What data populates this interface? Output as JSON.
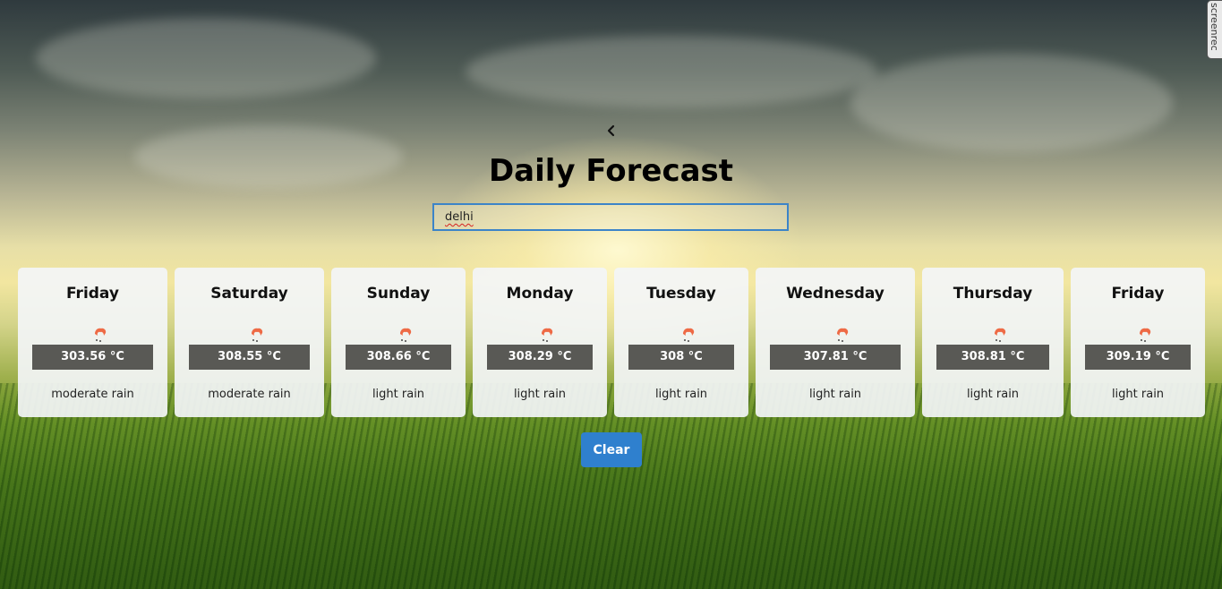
{
  "header": {
    "back_icon": "chevron-left-icon",
    "title": "Daily Forecast"
  },
  "search": {
    "value": "delhi"
  },
  "forecast": [
    {
      "day": "Friday",
      "temp": "303.56 °C",
      "desc": "moderate rain",
      "icon": "rain-cloud-icon"
    },
    {
      "day": "Saturday",
      "temp": "308.55 °C",
      "desc": "moderate rain",
      "icon": "rain-cloud-icon"
    },
    {
      "day": "Sunday",
      "temp": "308.66 °C",
      "desc": "light rain",
      "icon": "rain-cloud-icon"
    },
    {
      "day": "Monday",
      "temp": "308.29 °C",
      "desc": "light rain",
      "icon": "rain-cloud-icon"
    },
    {
      "day": "Tuesday",
      "temp": "308 °C",
      "desc": "light rain",
      "icon": "rain-cloud-icon"
    },
    {
      "day": "Wednesday",
      "temp": "307.81 °C",
      "desc": "light rain",
      "icon": "rain-cloud-icon"
    },
    {
      "day": "Thursday",
      "temp": "308.81 °C",
      "desc": "light rain",
      "icon": "rain-cloud-icon"
    },
    {
      "day": "Friday",
      "temp": "309.19 °C",
      "desc": "light rain",
      "icon": "rain-cloud-icon"
    }
  ],
  "actions": {
    "clear_label": "Clear"
  },
  "overlay": {
    "recorder_label": "screenrec"
  },
  "colors": {
    "accent": "#2f80ce",
    "temp_bar": "#595955",
    "icon": "#ee6a45"
  }
}
